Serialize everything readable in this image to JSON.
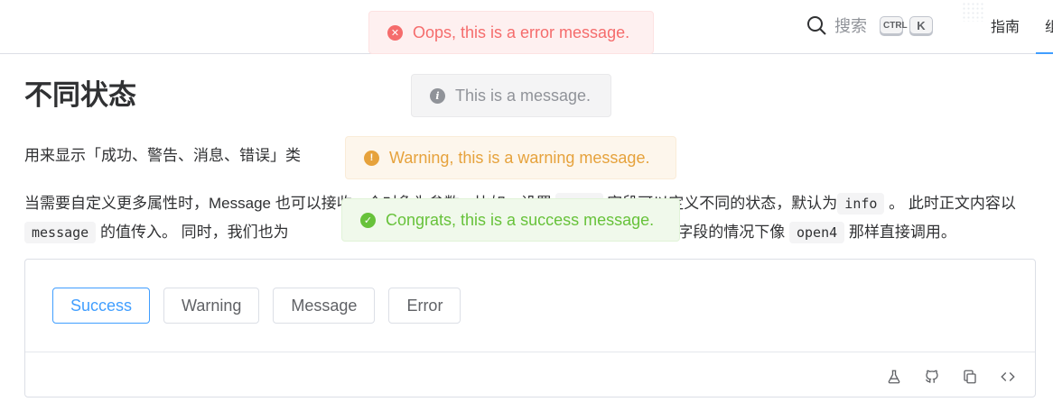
{
  "nav": {
    "search_label": "搜索",
    "kbd_ctrl": "CTRL",
    "kbd_k": "K",
    "link_guide": "指南",
    "link_cut": "组"
  },
  "content": {
    "title": "不同状态",
    "p1": "用来显示「成功、警告、消息、错误」类",
    "p2": {
      "a": "当需要自定义更多属性时，Message 也可以接收一个对象为参数。比如，设置 ",
      "code_type": "type",
      "b": " 字段可以定义不同的状态，默认为",
      "code_info": "info",
      "c": " 。 此时正文内容以 ",
      "code_message": "message",
      "d": " 的值传入。 同时，我们也为",
      "e": "入 type 字段的情况下像 ",
      "code_open4": "open4",
      "f": " 那样直接调用。"
    }
  },
  "demo": {
    "buttons": [
      "Success",
      "Warning",
      "Message",
      "Error"
    ]
  },
  "messages": {
    "error": "Oops, this is a error message.",
    "info": "This is a message.",
    "warning": "Warning, this is a warning message.",
    "success": "Congrats, this is a success message."
  },
  "icons": {
    "error": "close-circle-icon",
    "info": "info-circle-icon",
    "warning": "warning-circle-icon",
    "success": "check-circle-icon"
  },
  "colors": {
    "primary": "#409eff",
    "success": "#67c23a",
    "warning": "#e6a23c",
    "error": "#f56c6c",
    "info": "#909399"
  }
}
